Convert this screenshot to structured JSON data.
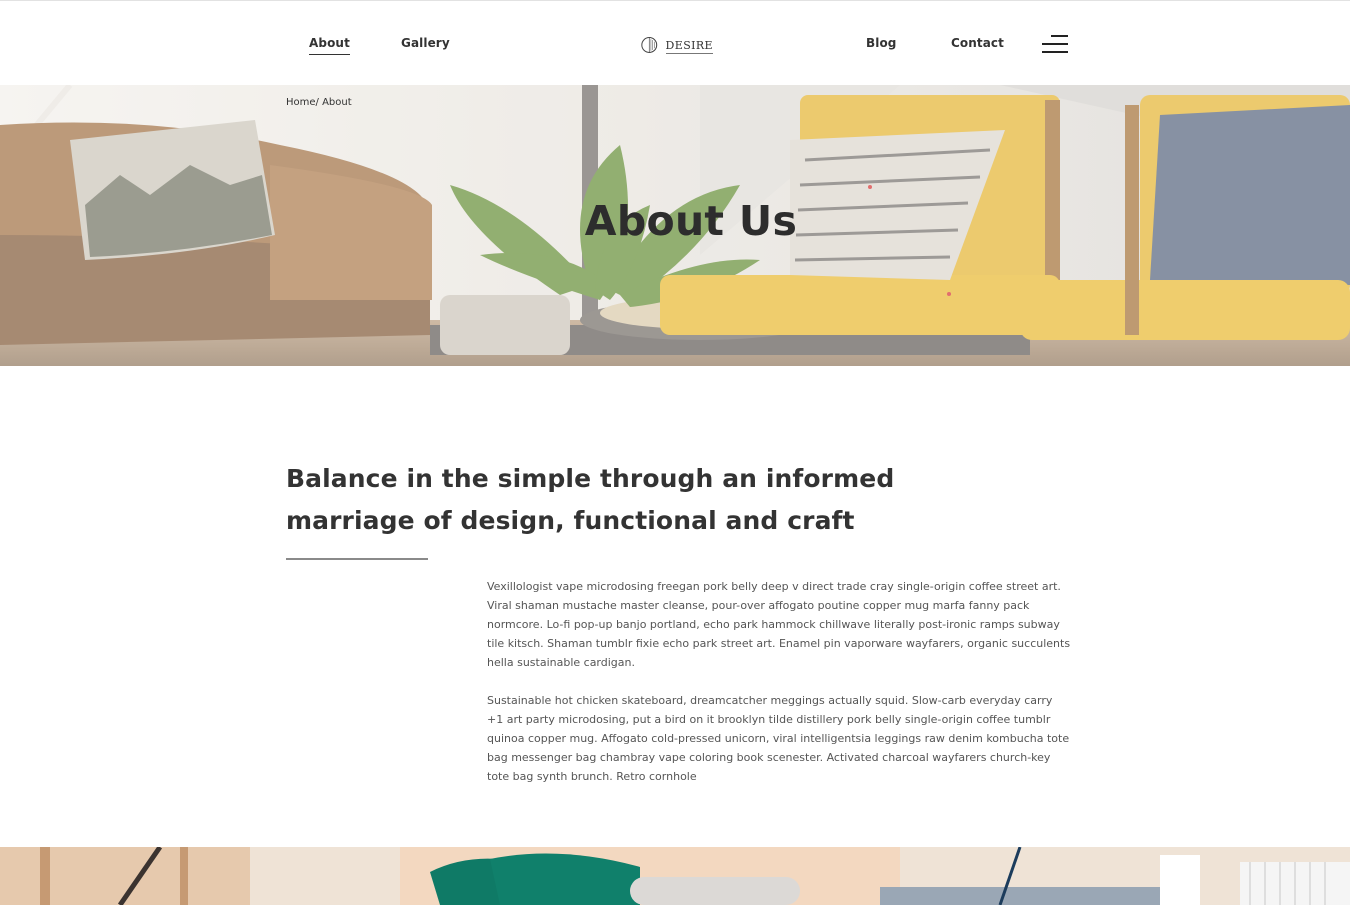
{
  "nav": {
    "about": "About",
    "gallery": "Gallery",
    "blog": "Blog",
    "contact": "Contact"
  },
  "logo": {
    "text": "DESIRE",
    "icon": "half-circle-logo-icon"
  },
  "menu": {
    "icon": "hamburger-menu-icon"
  },
  "breadcrumb": {
    "home": "Home",
    "separator": "/",
    "current": " About"
  },
  "hero": {
    "title": "About Us"
  },
  "content": {
    "heading": "Balance in the simple through an informed marriage of design, functional and craft",
    "paragraphs": [
      "Vexillologist vape microdosing freegan pork belly deep v direct trade cray single-origin coffee street art. Viral shaman mustache master cleanse, pour-over affogato poutine copper mug marfa fanny pack normcore. Lo-fi pop-up banjo portland, echo park hammock chillwave literally post-ironic ramps subway tile kitsch. Shaman tumblr fixie echo park street art. Enamel pin vaporware wayfarers, organic succulents hella sustainable cardigan.",
      "Sustainable hot chicken skateboard, dreamcatcher meggings actually squid. Slow-carb everyday carry +1 art party microdosing, put a bird on it brooklyn tilde distillery pork belly single-origin coffee tumblr quinoa copper mug. Affogato cold-pressed unicorn, viral intelligentsia leggings raw denim kombucha tote bag messenger bag chambray vape coloring book scenester. Activated charcoal wayfarers church-key tote bag synth brunch. Retro cornhole"
    ]
  },
  "colors": {
    "text_dark": "#333333",
    "body_text": "#555555",
    "chair_yellow": "#e3b12a",
    "leather_brown": "#9c6a3c",
    "plant_green": "#5f8a2e"
  }
}
